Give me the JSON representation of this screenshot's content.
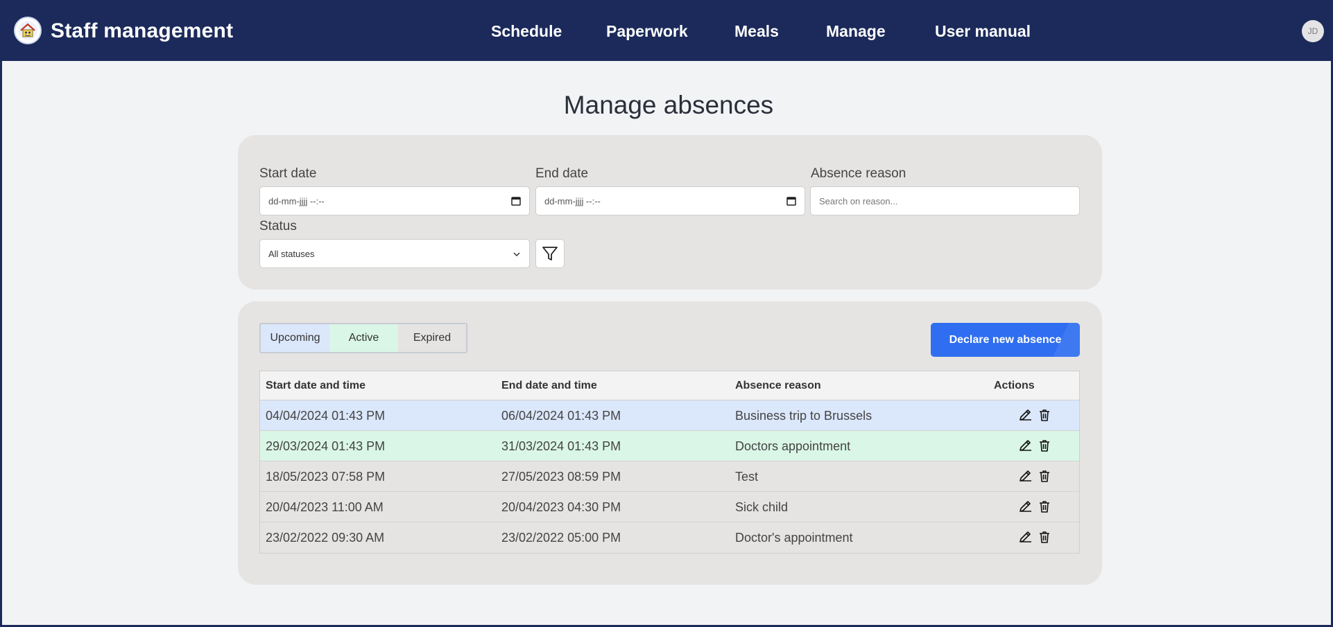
{
  "header": {
    "app_title": "Staff management",
    "nav": [
      {
        "label": "Schedule"
      },
      {
        "label": "Paperwork"
      },
      {
        "label": "Meals"
      },
      {
        "label": "Manage"
      },
      {
        "label": "User manual"
      }
    ],
    "avatar_initials": "JD",
    "bg_color": "#1b2a5a"
  },
  "page_title": "Manage absences",
  "filters": {
    "start_date": {
      "label": "Start date",
      "placeholder": "dd-mm-jjjj --:--"
    },
    "end_date": {
      "label": "End date",
      "placeholder": "dd-mm-jjjj --:--"
    },
    "reason": {
      "label": "Absence reason",
      "placeholder": "Search on reason..."
    },
    "status": {
      "label": "Status",
      "value": "All statuses"
    },
    "filter_icon": "funnel-icon"
  },
  "tabs": [
    {
      "label": "Upcoming",
      "color": "#dbe7fb"
    },
    {
      "label": "Active",
      "color": "#daf6e6"
    },
    {
      "label": "Expired",
      "color": "#e5e4e2"
    }
  ],
  "declare_button": "Declare new absence",
  "table": {
    "headers": [
      "Start date and time",
      "End date and time",
      "Absence reason",
      "Actions"
    ],
    "rows": [
      {
        "start": "04/04/2024 01:43 PM",
        "end": "06/04/2024 01:43 PM",
        "reason": "Business trip to Brussels",
        "status": "upcoming"
      },
      {
        "start": "29/03/2024 01:43 PM",
        "end": "31/03/2024 01:43 PM",
        "reason": "Doctors appointment",
        "status": "active"
      },
      {
        "start": "18/05/2023 07:58 PM",
        "end": "27/05/2023 08:59 PM",
        "reason": "Test",
        "status": "expired"
      },
      {
        "start": "20/04/2023 11:00 AM",
        "end": "20/04/2023 04:30 PM",
        "reason": "Sick child",
        "status": "expired"
      },
      {
        "start": "23/02/2022 09:30 AM",
        "end": "23/02/2022 05:00 PM",
        "reason": "Doctor's appointment",
        "status": "expired"
      }
    ],
    "row_colors": {
      "upcoming": "#dbe7fb",
      "active": "#daf6e6",
      "expired": "#e5e4e2"
    },
    "action_icons": [
      "pencil-icon",
      "trash-icon"
    ]
  }
}
